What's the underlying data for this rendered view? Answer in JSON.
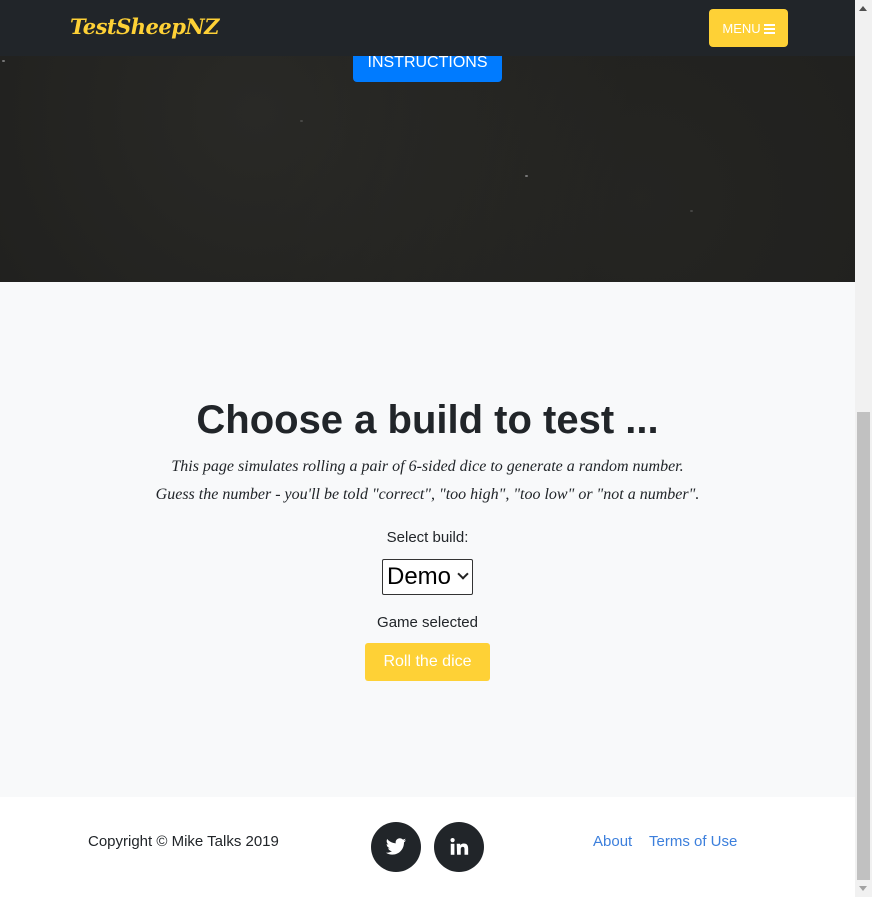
{
  "navbar": {
    "brand": "TestSheepNZ",
    "menu_label": "MENU",
    "brand_color": "#fed136"
  },
  "hero": {
    "instructions_label": "INSTRUCTIONS"
  },
  "main": {
    "heading": "Choose a build to test ...",
    "description_line1": "This page simulates rolling a pair of 6-sided dice to generate a random number.",
    "description_line2": "Guess the number - you'll be told \"correct\", \"too high\", \"too low\" or \"not a number\".",
    "select_label": "Select build:",
    "selected_build": "Demo",
    "status_text": "Game selected",
    "roll_label": "Roll the dice"
  },
  "footer": {
    "copyright": "Copyright © Mike Talks 2019",
    "social": [
      {
        "icon": "twitter-icon"
      },
      {
        "icon": "linkedin-icon"
      }
    ],
    "links": [
      {
        "label": "About"
      },
      {
        "label": "Terms of Use"
      }
    ]
  },
  "colors": {
    "accent": "#fed136",
    "primary": "#007bff",
    "dark": "#212529",
    "link": "#3c7fdc"
  }
}
